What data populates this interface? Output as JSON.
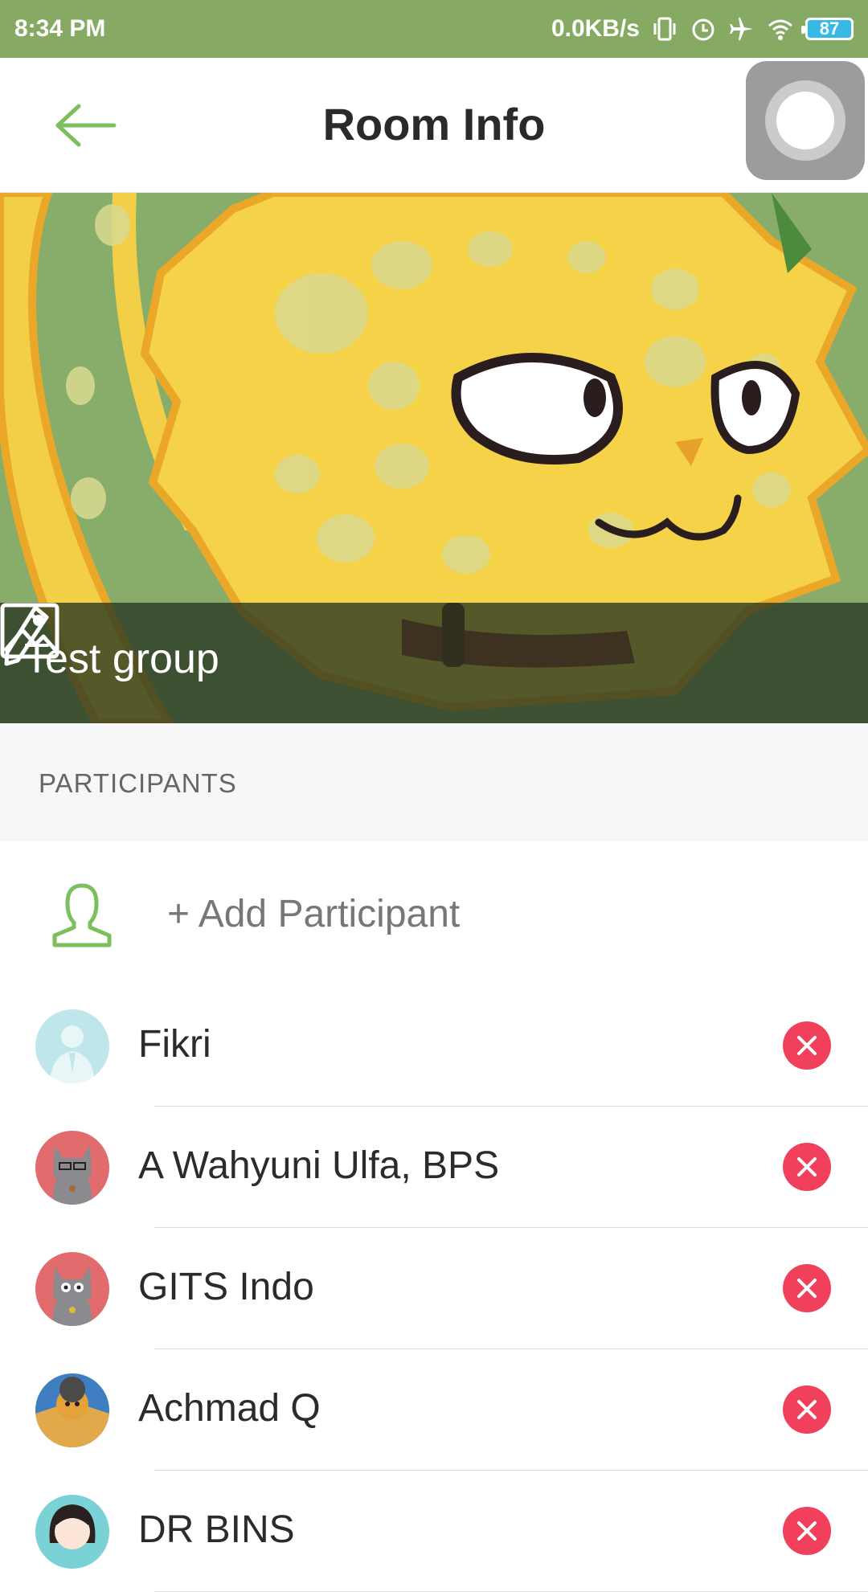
{
  "status_bar": {
    "time": "8:34 PM",
    "net_speed": "0.0KB/s",
    "battery": "87",
    "icons": [
      "vibrate-icon",
      "alarm-icon",
      "airplane-icon",
      "wifi-icon",
      "battery-icon"
    ]
  },
  "header": {
    "title": "Room Info",
    "back_icon": "arrow-left-icon",
    "accent": "#7cc05e"
  },
  "cover": {
    "group_name": "Test group",
    "edit_icon": "pencil-icon",
    "image_icon": "image-icon"
  },
  "section": {
    "title": "PARTICIPANTS"
  },
  "add_participant": {
    "label": "+ Add Participant",
    "icon": "person-outline-icon"
  },
  "participants": [
    {
      "name": "Fikri"
    },
    {
      "name": "A Wahyuni Ulfa, BPS"
    },
    {
      "name": "GITS Indo"
    },
    {
      "name": "Achmad Q"
    },
    {
      "name": "DR BINS"
    }
  ],
  "colors": {
    "status_bar": "#86aa64",
    "remove": "#f0405c",
    "accent_green": "#7cc05e"
  }
}
